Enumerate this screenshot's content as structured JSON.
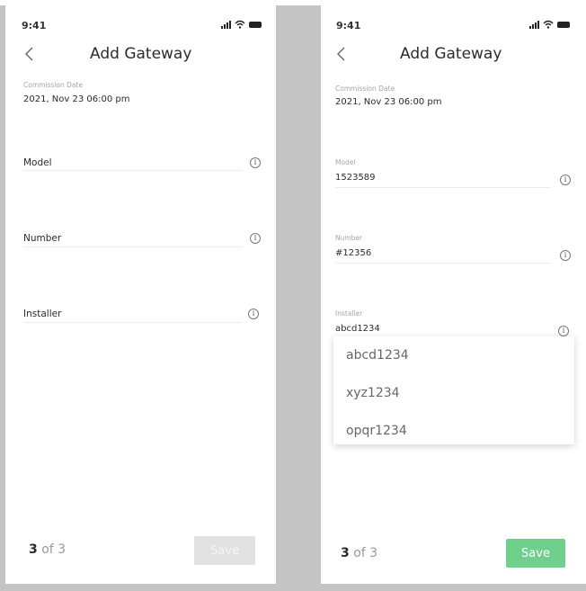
{
  "colors": {
    "save_disabled": "#e1e1e1",
    "save_enabled": "#6fd08c",
    "label_gray": "#a5a5a5"
  },
  "left": {
    "status": {
      "time": "9:41"
    },
    "title": "Add Gateway",
    "commission": {
      "label": "Commission Date",
      "value": "2021, Nov 23   06:00 pm"
    },
    "model": {
      "placeholder": "Model"
    },
    "number": {
      "placeholder": "Number"
    },
    "installer": {
      "placeholder": "Installer"
    },
    "pager": {
      "current": "3",
      "total_text": " of 3"
    },
    "save_label": "Save"
  },
  "right": {
    "status": {
      "time": "9:41"
    },
    "title": "Add Gateway",
    "commission": {
      "label": "Commission Date",
      "value": "2021, Nov 23   06:00 pm"
    },
    "model": {
      "label": "Model",
      "value": "1523589"
    },
    "number": {
      "label": "Number",
      "value": "#12356"
    },
    "installer": {
      "label": "Installer",
      "value": "abcd1234"
    },
    "dropdown": {
      "options": [
        "abcd1234",
        "xyz1234",
        "opqr1234"
      ]
    },
    "pager": {
      "current": "3",
      "total_text": " of 3"
    },
    "save_label": "Save"
  }
}
